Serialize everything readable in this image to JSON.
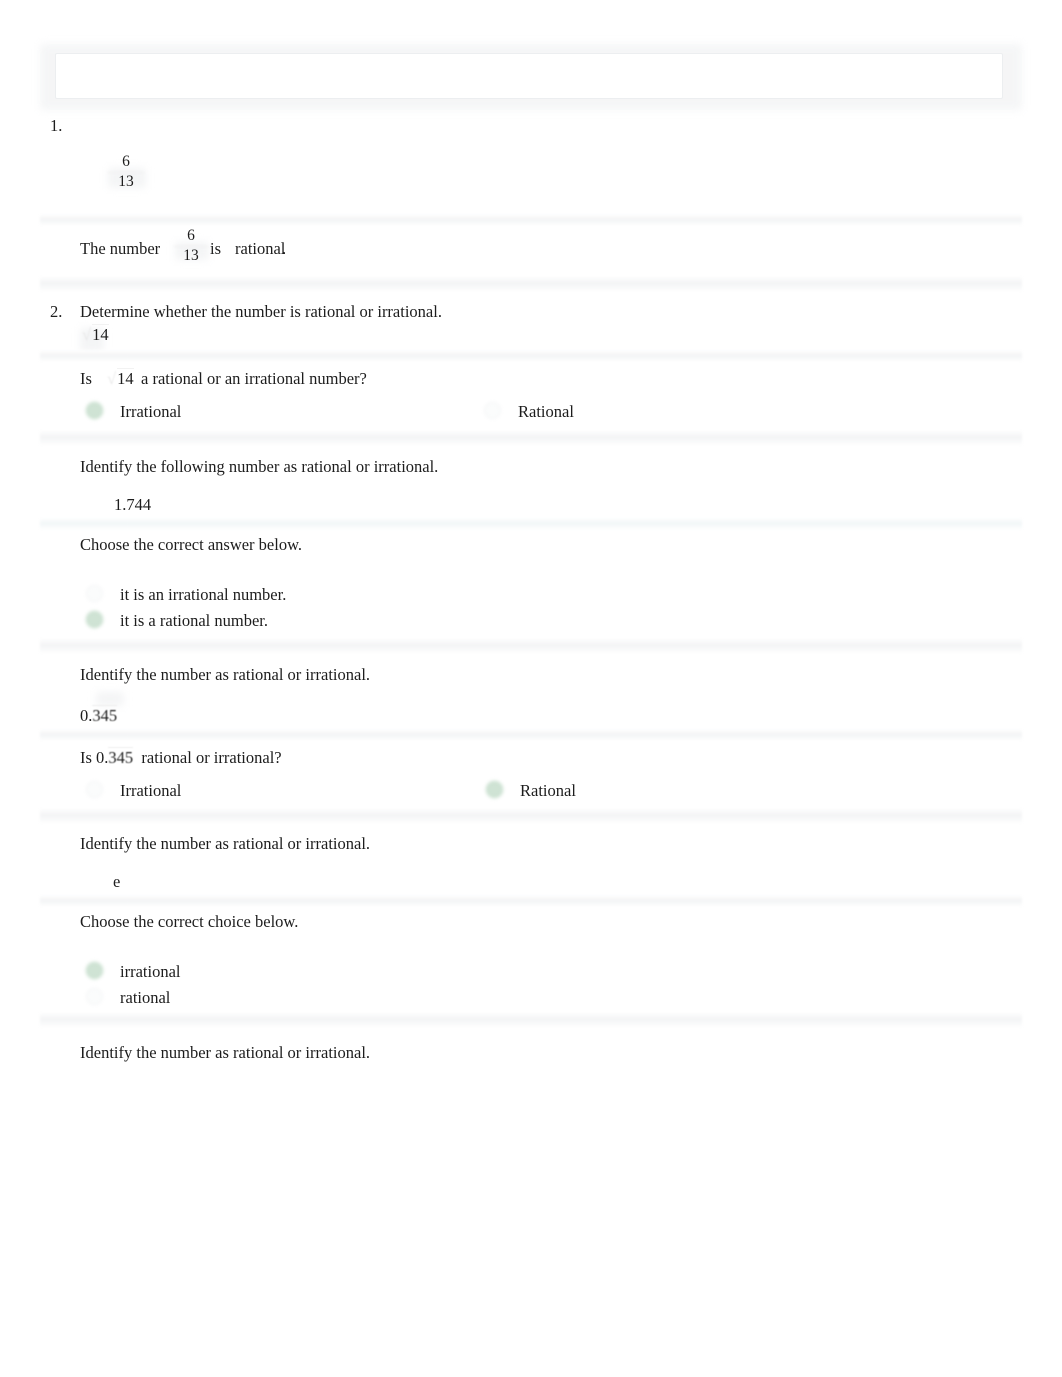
{
  "document": {
    "title": "Identify rational or irrational numbers worksheet",
    "topbar_value": "",
    "topbar_placeholder": ""
  },
  "colors": {
    "selected_radio": "#cfe3d4",
    "unselected_radio": "#fbfcfc",
    "divider": "#f3f4f5",
    "divider_blue": "#f1f6f7",
    "text": "#1d1d1d"
  },
  "problems": [
    {
      "number": "1.",
      "prompt": "",
      "expression": {
        "type": "fraction",
        "numerator": "6",
        "denominator": "13"
      },
      "answer_sentence": {
        "lead": "The number",
        "fraction": {
          "numerator": "6",
          "denominator": "13"
        },
        "verb": "is",
        "selection": "rational",
        "trailing": "."
      }
    },
    {
      "number": "2.",
      "prompt": "Determine whether the number is rational or irrational.",
      "expression": {
        "type": "radical",
        "radicand": "14"
      },
      "question": {
        "lead": "Is",
        "radicand": "14",
        "tail": "a rational or an irrational number?"
      },
      "options": [
        {
          "label": "Irrational",
          "selected": true
        },
        {
          "label": "Rational",
          "selected": false
        }
      ]
    },
    {
      "number": "",
      "prompt": "Identify the following number as rational or irrational.",
      "expression": {
        "type": "decimal",
        "value": "1.744"
      },
      "choose_label": "Choose the correct answer below.",
      "options": [
        {
          "label": "it is an irrational number.",
          "selected": false
        },
        {
          "label": "it is a rational number.",
          "selected": true
        }
      ]
    },
    {
      "number": "",
      "prompt": "Identify the number as rational or irrational.",
      "expression": {
        "type": "repeating_decimal",
        "integer_part": "0.",
        "repeating_part": "345"
      },
      "question": {
        "lead": "Is",
        "value_integer": "0.",
        "value_repeating": "345",
        "tail": "rational or irrational?"
      },
      "options": [
        {
          "label": "Irrational",
          "selected": false
        },
        {
          "label": "Rational",
          "selected": true
        }
      ]
    },
    {
      "number": "",
      "prompt": "Identify the number as rational or irrational.",
      "expression": {
        "type": "constant",
        "value": "e"
      },
      "choose_label": "Choose the correct choice below.",
      "options": [
        {
          "label": "irrational",
          "selected": true
        },
        {
          "label": "rational",
          "selected": false
        }
      ]
    },
    {
      "number": "",
      "prompt": "Identify the number as rational or irrational.",
      "expression": null,
      "options": []
    }
  ]
}
